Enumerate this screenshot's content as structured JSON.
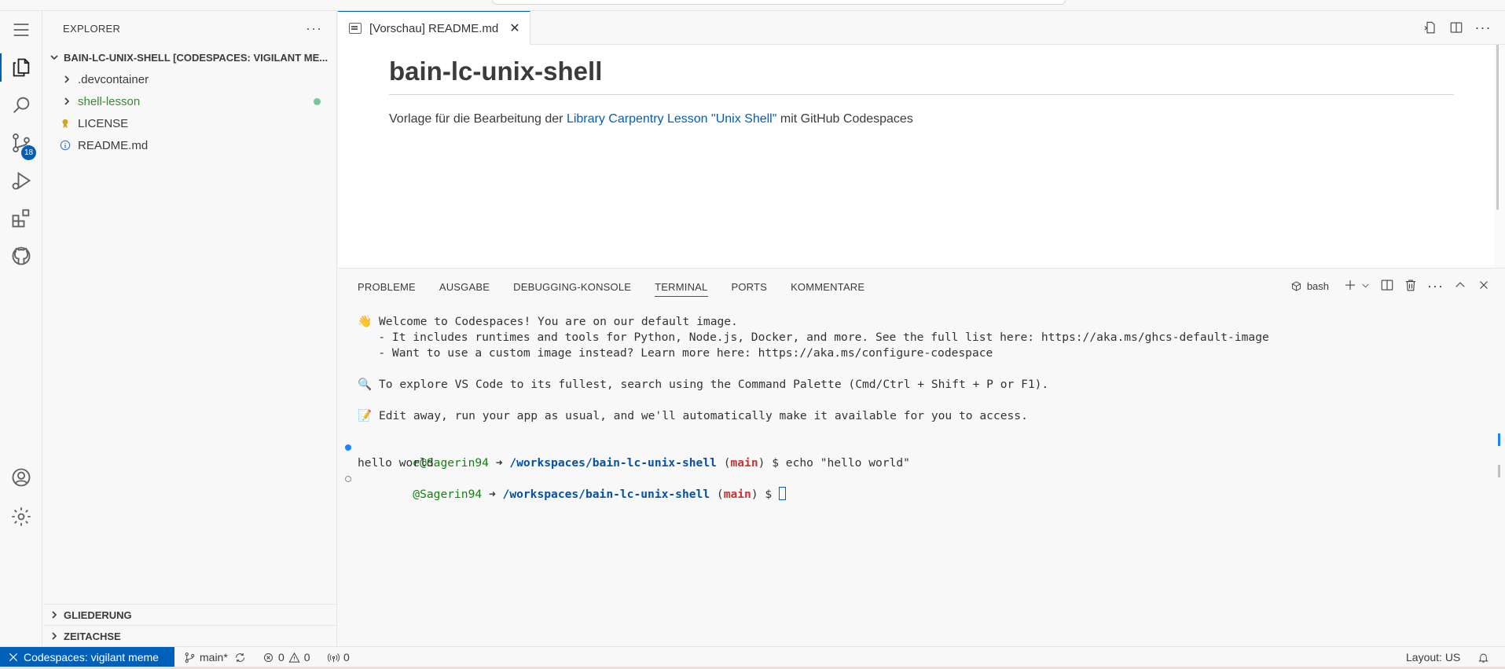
{
  "sidebar": {
    "title": "EXPLORER",
    "more": "···",
    "root_folder": "BAIN-LC-UNIX-SHELL [CODESPACES: VIGILANT ME...",
    "items": [
      {
        "label": ".devcontainer",
        "type": "folder"
      },
      {
        "label": "shell-lesson",
        "type": "folder"
      },
      {
        "label": "LICENSE",
        "type": "file"
      },
      {
        "label": "README.md",
        "type": "file"
      }
    ],
    "outline": "GLIEDERUNG",
    "timeline": "ZEITACHSE"
  },
  "activity": {
    "scm_badge": "18"
  },
  "editor": {
    "tab_label": "[Vorschau] README.md",
    "close": "✕",
    "heading": "bain-lc-unix-shell",
    "para_before": "Vorlage für die Bearbeitung der ",
    "link_text": "Library Carpentry Lesson \"Unix Shell\"",
    "para_after": " mit GitHub Codespaces",
    "more": "···"
  },
  "panel": {
    "tabs": [
      "PROBLEME",
      "AUSGABE",
      "DEBUGGING-KONSOLE",
      "TERMINAL",
      "PORTS",
      "KOMMENTARE"
    ],
    "terminal_name": "bash",
    "more": "···",
    "lines": {
      "welcome": "👋 Welcome to Codespaces! You are on our default image.",
      "runtimes": "   - It includes runtimes and tools for Python, Node.js, Docker, and more. See the full list here: https://aka.ms/ghcs-default-image",
      "custom": "   - Want to use a custom image instead? Learn more here: https://aka.ms/configure-codespace",
      "explore": "🔍 To explore VS Code to its fullest, search using the Command Palette (Cmd/Ctrl + Shift + P or F1).",
      "edit": "📝 Edit away, run your app as usual, and we'll automatically make it available for you to access.",
      "prompt1_user": "e@Sagerin94",
      "arrow": " ➜ ",
      "path": "/workspaces/bain-lc-unix-shell",
      "branch_open": " (",
      "branch": "main",
      "branch_close": ") $ ",
      "command": "echo \"hello world\"",
      "output": "hello world",
      "prompt2_user": "@Sagerin94"
    }
  },
  "status": {
    "remote": "Codespaces: vigilant meme",
    "branch": "main*",
    "errors": "0",
    "warnings": "0",
    "ports": "0",
    "layout": "Layout: US"
  }
}
